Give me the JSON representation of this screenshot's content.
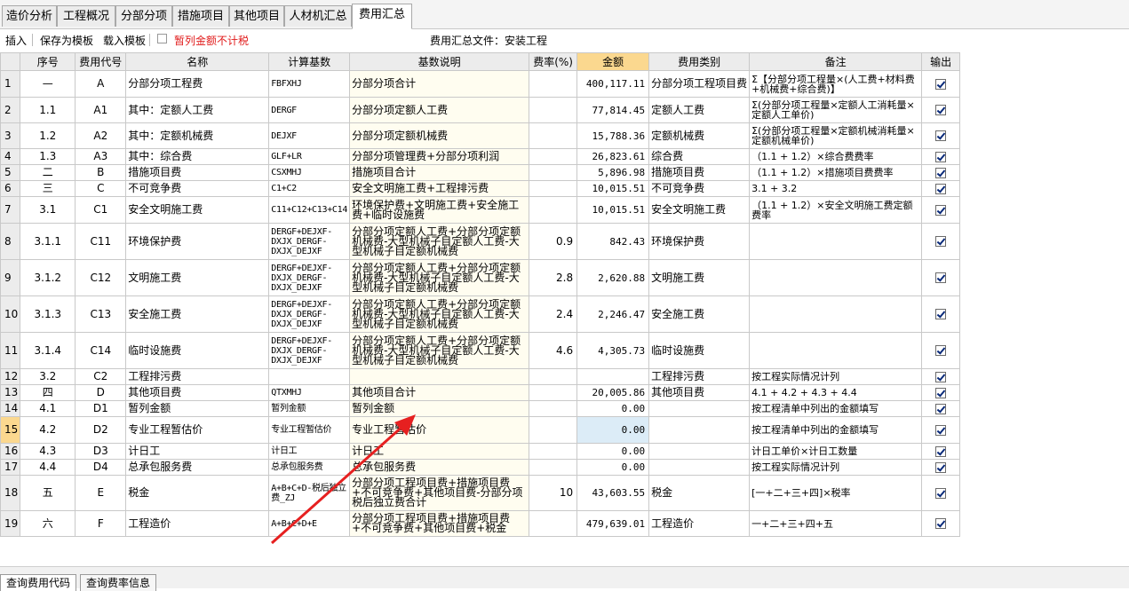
{
  "tabs": [
    "造价分析",
    "工程概况",
    "分部分项",
    "措施项目",
    "其他项目",
    "人材机汇总",
    "费用汇总"
  ],
  "toolbar": {
    "insert": "插入",
    "save_template": "保存为模板",
    "load_template": "载入模板",
    "provisional_label": "暂列金额不计税",
    "file_label": "费用汇总文件：安装工程"
  },
  "columns": [
    "序号",
    "费用代号",
    "名称",
    "计算基数",
    "基数说明",
    "费率(%)",
    "金额",
    "费用类别",
    "备注",
    "输出"
  ],
  "rows": [
    {
      "n": "1",
      "seq": "—",
      "code": "A",
      "name": "分部分项工程费",
      "base": "FBFXHJ",
      "desc": "分部分项合计",
      "rate": "",
      "amount": "400,117.11",
      "cat": "分部分项工程项目费",
      "note": "Σ【分部分项工程量×(人工费+材料费+机械费+综合费)】",
      "out": true
    },
    {
      "n": "2",
      "seq": "1.1",
      "code": "A1",
      "name": "其中：定额人工费",
      "base": "DERGF",
      "desc": "分部分项定额人工费",
      "rate": "",
      "amount": "77,814.45",
      "cat": "定额人工费",
      "note": "Σ(分部分项工程量×定额人工消耗量×定额人工单价)",
      "out": true
    },
    {
      "n": "3",
      "seq": "1.2",
      "code": "A2",
      "name": "其中：定额机械费",
      "base": "DEJXF",
      "desc": "分部分项定额机械费",
      "rate": "",
      "amount": "15,788.36",
      "cat": "定额机械费",
      "note": "Σ(分部分项工程量×定额机械消耗量×定额机械单价)",
      "out": true
    },
    {
      "n": "4",
      "seq": "1.3",
      "code": "A3",
      "name": "其中：综合费",
      "base": "GLF+LR",
      "desc": "分部分项管理费+分部分项利润",
      "rate": "",
      "amount": "26,823.61",
      "cat": "综合费",
      "note": "（1.1 + 1.2）×综合费费率",
      "out": true
    },
    {
      "n": "5",
      "seq": "二",
      "code": "B",
      "name": "措施项目费",
      "base": "CSXMHJ",
      "desc": "措施项目合计",
      "rate": "",
      "amount": "5,896.98",
      "cat": "措施项目费",
      "note": "（1.1 + 1.2）×措施项目费费率",
      "out": true
    },
    {
      "n": "6",
      "seq": "三",
      "code": "C",
      "name": "不可竞争费",
      "base": "C1+C2",
      "desc": "安全文明施工费+工程排污费",
      "rate": "",
      "amount": "10,015.51",
      "cat": "不可竞争费",
      "note": "3.1 + 3.2",
      "out": true
    },
    {
      "n": "7",
      "seq": "3.1",
      "code": "C1",
      "name": "安全文明施工费",
      "base": "C11+C12+C13+C14",
      "desc": "环境保护费+文明施工费+安全施工费+临时设施费",
      "rate": "",
      "amount": "10,015.51",
      "cat": "安全文明施工费",
      "note": "（1.1 + 1.2）×安全文明施工费定额费率",
      "out": true
    },
    {
      "n": "8",
      "seq": "3.1.1",
      "code": "C11",
      "name": "环境保护费",
      "base": "DERGF+DEJXF-DXJX_DERGF-DXJX_DEJXF",
      "desc": "分部分项定额人工费+分部分项定额机械费-大型机械子目定额人工费-大型机械子目定额机械费",
      "rate": "0.9",
      "amount": "842.43",
      "cat": "环境保护费",
      "note": "",
      "out": true
    },
    {
      "n": "9",
      "seq": "3.1.2",
      "code": "C12",
      "name": "文明施工费",
      "base": "DERGF+DEJXF-DXJX_DERGF-DXJX_DEJXF",
      "desc": "分部分项定额人工费+分部分项定额机械费-大型机械子目定额人工费-大型机械子目定额机械费",
      "rate": "2.8",
      "amount": "2,620.88",
      "cat": "文明施工费",
      "note": "",
      "out": true
    },
    {
      "n": "10",
      "seq": "3.1.3",
      "code": "C13",
      "name": "安全施工费",
      "base": "DERGF+DEJXF-DXJX_DERGF-DXJX_DEJXF",
      "desc": "分部分项定额人工费+分部分项定额机械费-大型机械子目定额人工费-大型机械子目定额机械费",
      "rate": "2.4",
      "amount": "2,246.47",
      "cat": "安全施工费",
      "note": "",
      "out": true
    },
    {
      "n": "11",
      "seq": "3.1.4",
      "code": "C14",
      "name": "临时设施费",
      "base": "DERGF+DEJXF-DXJX_DERGF-DXJX_DEJXF",
      "desc": "分部分项定额人工费+分部分项定额机械费-大型机械子目定额人工费-大型机械子目定额机械费",
      "rate": "4.6",
      "amount": "4,305.73",
      "cat": "临时设施费",
      "note": "",
      "out": true
    },
    {
      "n": "12",
      "seq": "3.2",
      "code": "C2",
      "name": "工程排污费",
      "base": "",
      "desc": "",
      "rate": "",
      "amount": "",
      "cat": "工程排污费",
      "note": "按工程实际情况计列",
      "out": true
    },
    {
      "n": "13",
      "seq": "四",
      "code": "D",
      "name": "其他项目费",
      "base": "QTXMHJ",
      "desc": "其他项目合计",
      "rate": "",
      "amount": "20,005.86",
      "cat": "其他项目费",
      "note": "4.1 + 4.2 + 4.3 + 4.4",
      "out": true
    },
    {
      "n": "14",
      "seq": "4.1",
      "code": "D1",
      "name": "暂列金额",
      "base": "暂列金额",
      "desc": "暂列金额",
      "rate": "",
      "amount": "0.00",
      "cat": "",
      "note": "按工程清单中列出的金额填写",
      "out": true
    },
    {
      "n": "15",
      "seq": "4.2",
      "code": "D2",
      "name": "专业工程暂估价",
      "base": "专业工程暂估价",
      "desc": "专业工程暂估价",
      "rate": "",
      "amount": "0.00",
      "cat": "",
      "note": "按工程清单中列出的金额填写",
      "out": true
    },
    {
      "n": "16",
      "seq": "4.3",
      "code": "D3",
      "name": "计日工",
      "base": "计日工",
      "desc": "计日工",
      "rate": "",
      "amount": "0.00",
      "cat": "",
      "note": "计日工单价×计日工数量",
      "out": true
    },
    {
      "n": "17",
      "seq": "4.4",
      "code": "D4",
      "name": "总承包服务费",
      "base": "总承包服务费",
      "desc": "总承包服务费",
      "rate": "",
      "amount": "0.00",
      "cat": "",
      "note": "按工程实际情况计列",
      "out": true
    },
    {
      "n": "18",
      "seq": "五",
      "code": "E",
      "name": "税金",
      "base": "A+B+C+D-税后独立费_ZJ",
      "desc": "分部分项工程项目费+措施项目费+不可竞争费+其他项目费-分部分项税后独立费合计",
      "rate": "10",
      "amount": "43,603.55",
      "cat": "税金",
      "note": "[一+二+三+四]×税率",
      "out": true
    },
    {
      "n": "19",
      "seq": "六",
      "code": "F",
      "name": "工程造价",
      "base": "A+B+C+D+E",
      "desc": "分部分项工程项目费+措施项目费+不可竞争费+其他项目费+税金",
      "rate": "",
      "amount": "479,639.01",
      "cat": "工程造价",
      "note": "一+二+三+四+五",
      "out": true
    }
  ],
  "bottom_tabs": [
    "查询费用代码",
    "查询费率信息"
  ],
  "colors": {
    "selected_row": "#fbd88f",
    "amount_header": "#fbd88f",
    "arrow": "#e62020",
    "warning_text": "#e11b1b"
  }
}
